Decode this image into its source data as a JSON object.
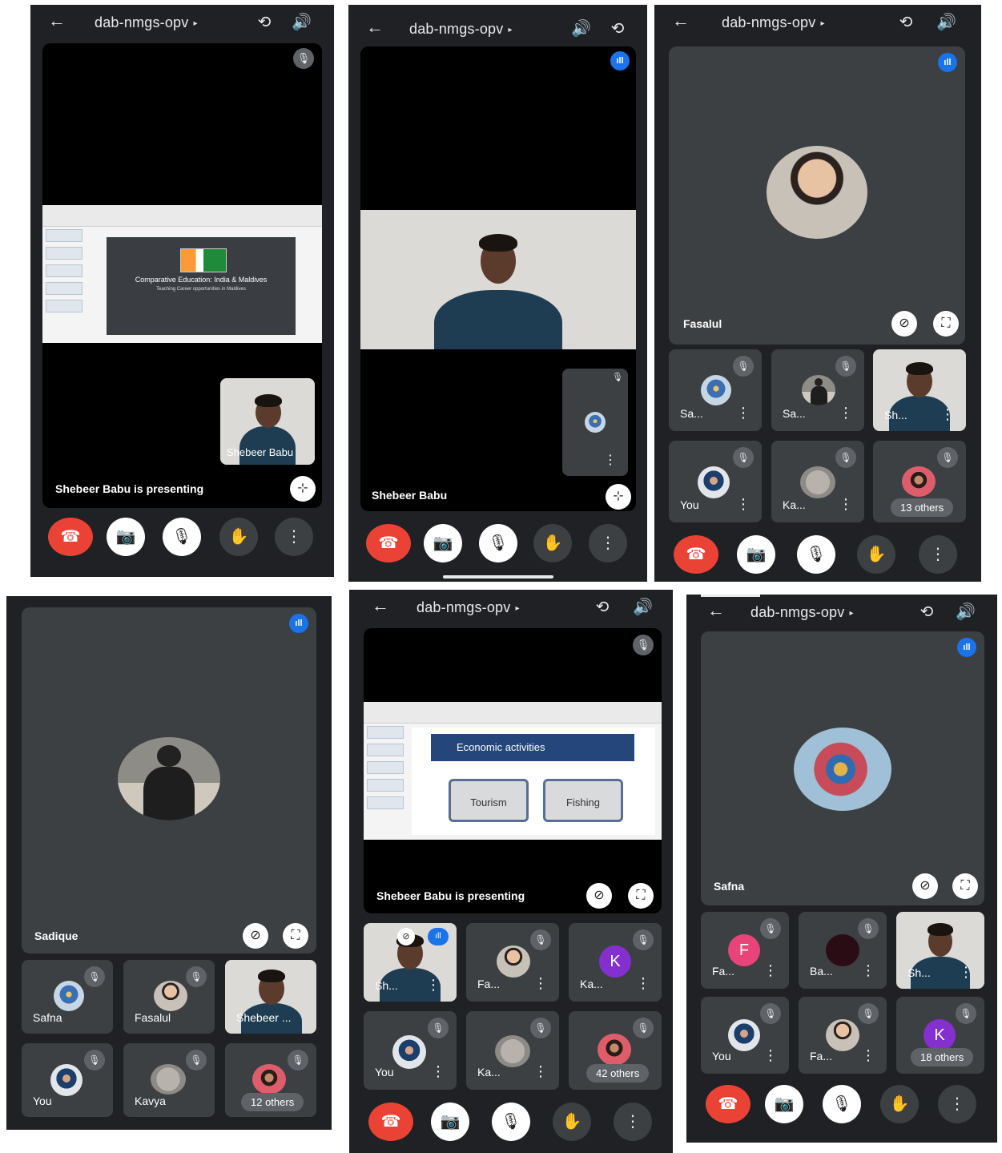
{
  "meeting_code": "dab-nmgs-opv",
  "icons": {
    "back": "←",
    "dropdown": "▸",
    "switch_camera": "⟲",
    "speaker": "🔊",
    "mic_off": "🎙",
    "end_call": "☎",
    "camera_off": "📷",
    "raise_hand": "✋",
    "more": "⋮",
    "fullscreen": "⛶",
    "unpin": "⊘",
    "exit_fullscreen": "⊹",
    "speaking": "ıll"
  },
  "screen1": {
    "presenter_label": "Shebeer Babu is presenting",
    "self_tile_name": "Shebeer Babu",
    "slide_title": "Comparative Education: India & Maldives",
    "slide_subtitle": "Teaching Career opportunities in Maldives"
  },
  "screen2": {
    "main_name": "Shebeer Babu"
  },
  "screen3": {
    "pinned_name": "Fasalul",
    "tiles": [
      "Sa...",
      "Sa...",
      "Sh...",
      "You",
      "Ka...",
      "13 others"
    ]
  },
  "screen4": {
    "pinned_name": "Sadique",
    "tiles": [
      "Safna",
      "Fasalul",
      "Shebeer ...",
      "You",
      "Kavya",
      "12 others"
    ]
  },
  "screen5": {
    "presenter_label": "Shebeer Babu is presenting",
    "slide_heading": "Economic activities",
    "slide_box1": "Tourism",
    "slide_box2": "Fishing",
    "tiles": [
      "Sh...",
      "Fa...",
      "Ka...",
      "You",
      "Ka...",
      "42 others"
    ],
    "k_letter": "K"
  },
  "screen6": {
    "pinned_name": "Safna",
    "tiles": [
      "Fa...",
      "Ba...",
      "Sh...",
      "You",
      "Fa...",
      "18 others"
    ],
    "f_letter": "F",
    "k_letter": "K"
  },
  "colors": {
    "end_call": "#ea4335",
    "speaking_badge": "#1a73e8",
    "avatar_pink": "#e8447a",
    "avatar_purple": "#8430ce"
  }
}
